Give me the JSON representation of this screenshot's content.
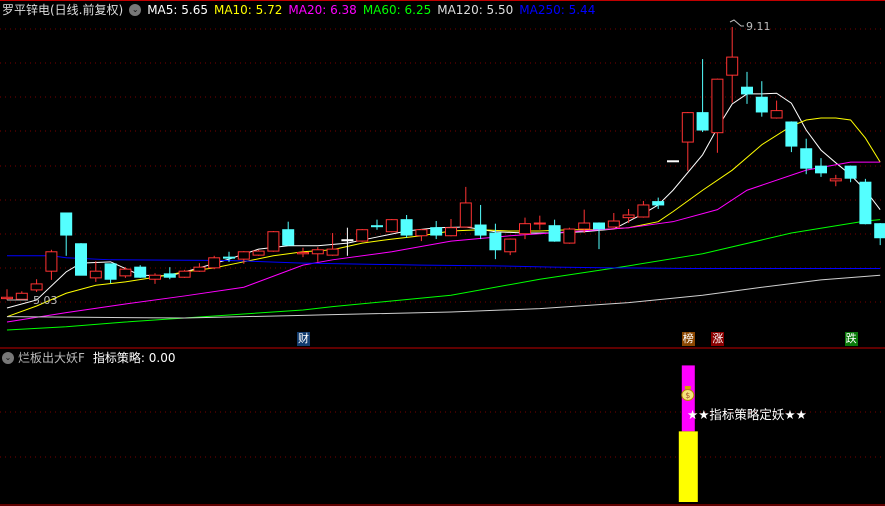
{
  "header": {
    "title": "罗平锌电(日线.前复权)",
    "ma": [
      {
        "label": "MA5: 5.65",
        "color": "#ffffff"
      },
      {
        "label": "MA10: 5.72",
        "color": "#ffff00"
      },
      {
        "label": "MA20: 6.38",
        "color": "#ff00ff"
      },
      {
        "label": "MA60: 6.25",
        "color": "#00ff00"
      },
      {
        "label": "MA120: 5.50",
        "color": "#dddddd"
      },
      {
        "label": "MA250: 5.44",
        "color": "#0000ff"
      }
    ]
  },
  "annotations": {
    "high_label": "9.11",
    "low_label": "5.03"
  },
  "markers": [
    {
      "text": "财",
      "bar": 21,
      "color": "#123c6e"
    },
    {
      "text": "榜",
      "bar": 47,
      "color": "#8a4600"
    },
    {
      "text": "涨",
      "bar": 49,
      "color": "#8b0000"
    },
    {
      "text": "跌",
      "bar": 58,
      "color": "#0a7a0a"
    }
  ],
  "indicator": {
    "name": "烂板出大妖F",
    "value_label": "指标策略: 0.00",
    "signal_text": "★★指标策略定妖★★",
    "signal_bar": 47,
    "yellow_level": 0.45,
    "magenta_level": 0.87,
    "yellow_color": "#ffff00",
    "magenta_color": "#ff00ff"
  },
  "chart_data": {
    "type": "candlestick",
    "ylim": [
      4.55,
      9.25
    ],
    "up_color": "#ff3333",
    "down_color": "#54ffff",
    "ohlc": [
      [
        5.05,
        5.19,
        5.03,
        5.07
      ],
      [
        5.04,
        5.16,
        5.03,
        5.13
      ],
      [
        5.18,
        5.34,
        5.15,
        5.27
      ],
      [
        5.46,
        5.78,
        5.33,
        5.75
      ],
      [
        6.33,
        6.33,
        5.69,
        6.0
      ],
      [
        5.87,
        5.88,
        5.4,
        5.4
      ],
      [
        5.36,
        5.61,
        5.3,
        5.46
      ],
      [
        5.57,
        5.57,
        5.28,
        5.34
      ],
      [
        5.39,
        5.52,
        5.36,
        5.49
      ],
      [
        5.52,
        5.55,
        5.36,
        5.37
      ],
      [
        5.34,
        5.43,
        5.27,
        5.4
      ],
      [
        5.42,
        5.52,
        5.34,
        5.37
      ],
      [
        5.37,
        5.48,
        5.36,
        5.46
      ],
      [
        5.46,
        5.58,
        5.45,
        5.52
      ],
      [
        5.51,
        5.69,
        5.49,
        5.66
      ],
      [
        5.67,
        5.75,
        5.6,
        5.66
      ],
      [
        5.64,
        5.76,
        5.57,
        5.75
      ],
      [
        5.7,
        5.78,
        5.69,
        5.76
      ],
      [
        5.76,
        6.06,
        5.75,
        6.05
      ],
      [
        6.08,
        6.2,
        5.84,
        5.85
      ],
      [
        5.72,
        5.81,
        5.67,
        5.74
      ],
      [
        5.72,
        5.82,
        5.6,
        5.78
      ],
      [
        5.7,
        6.03,
        5.69,
        5.79
      ],
      [
        5.93,
        6.11,
        5.69,
        5.93
      ],
      [
        5.91,
        6.09,
        5.9,
        6.08
      ],
      [
        6.14,
        6.23,
        6.08,
        6.13
      ],
      [
        6.05,
        6.24,
        6.04,
        6.23
      ],
      [
        6.23,
        6.3,
        5.96,
        6.0
      ],
      [
        5.99,
        6.09,
        5.91,
        6.08
      ],
      [
        6.11,
        6.21,
        5.94,
        6.0
      ],
      [
        5.99,
        6.24,
        5.98,
        6.11
      ],
      [
        6.12,
        6.72,
        6.11,
        6.48
      ],
      [
        6.15,
        6.45,
        5.94,
        6.0
      ],
      [
        6.03,
        6.17,
        5.64,
        5.78
      ],
      [
        5.75,
        5.95,
        5.7,
        5.94
      ],
      [
        6.02,
        6.26,
        5.94,
        6.17
      ],
      [
        6.17,
        6.29,
        6.08,
        6.18
      ],
      [
        6.14,
        6.23,
        5.9,
        5.91
      ],
      [
        5.88,
        6.11,
        5.87,
        6.09
      ],
      [
        6.09,
        6.38,
        6.03,
        6.18
      ],
      [
        6.18,
        6.19,
        5.79,
        6.09
      ],
      [
        6.12,
        6.33,
        6.11,
        6.21
      ],
      [
        6.26,
        6.39,
        6.18,
        6.3
      ],
      [
        6.27,
        6.51,
        6.26,
        6.45
      ],
      [
        6.5,
        6.56,
        6.39,
        6.45
      ],
      [
        7.11,
        7.11,
        7.11,
        7.11
      ],
      [
        7.39,
        7.84,
        6.96,
        7.83
      ],
      [
        7.83,
        8.63,
        7.54,
        7.57
      ],
      [
        7.53,
        8.34,
        7.23,
        8.33
      ],
      [
        8.39,
        9.11,
        7.98,
        8.66
      ],
      [
        8.21,
        8.44,
        7.96,
        8.11
      ],
      [
        8.06,
        8.3,
        7.77,
        7.84
      ],
      [
        7.75,
        8.01,
        7.74,
        7.86
      ],
      [
        7.69,
        7.7,
        7.24,
        7.33
      ],
      [
        7.29,
        7.44,
        6.91,
        7.0
      ],
      [
        7.03,
        7.15,
        6.87,
        6.93
      ],
      [
        6.81,
        6.9,
        6.73,
        6.84
      ],
      [
        7.03,
        7.04,
        6.79,
        6.85
      ],
      [
        6.79,
        6.84,
        6.16,
        6.17
      ],
      [
        6.17,
        6.18,
        5.85,
        5.96
      ]
    ],
    "ma_series": [
      {
        "name": "MA5",
        "color": "#ffffff",
        "points": [
          [
            1,
            4.91
          ],
          [
            3,
            5.03
          ],
          [
            5,
            5.45
          ],
          [
            6,
            5.58
          ],
          [
            8,
            5.6
          ],
          [
            10,
            5.4
          ],
          [
            12,
            5.39
          ],
          [
            14,
            5.51
          ],
          [
            16,
            5.64
          ],
          [
            18,
            5.79
          ],
          [
            20,
            5.84
          ],
          [
            22,
            5.84
          ],
          [
            24,
            5.88
          ],
          [
            26,
            5.97
          ],
          [
            28,
            6.06
          ],
          [
            30,
            6.11
          ],
          [
            32,
            6.12
          ],
          [
            34,
            6.05
          ],
          [
            36,
            6.03
          ],
          [
            38,
            6.03
          ],
          [
            40,
            6.05
          ],
          [
            42,
            6.09
          ],
          [
            44,
            6.32
          ],
          [
            45,
            6.45
          ],
          [
            46,
            6.67
          ],
          [
            48,
            7.2
          ],
          [
            49,
            7.6
          ],
          [
            50,
            7.96
          ],
          [
            51,
            8.11
          ],
          [
            52,
            8.11
          ],
          [
            53,
            8.12
          ],
          [
            54,
            7.97
          ],
          [
            55,
            7.57
          ],
          [
            56,
            7.27
          ],
          [
            57,
            7.08
          ],
          [
            58,
            6.9
          ],
          [
            59,
            6.67
          ],
          [
            60,
            6.38
          ]
        ]
      },
      {
        "name": "MA10",
        "color": "#ffff00",
        "points": [
          [
            1,
            4.78
          ],
          [
            3,
            4.94
          ],
          [
            5,
            5.13
          ],
          [
            7,
            5.25
          ],
          [
            9,
            5.3
          ],
          [
            11,
            5.37
          ],
          [
            13,
            5.45
          ],
          [
            15,
            5.51
          ],
          [
            17,
            5.6
          ],
          [
            19,
            5.69
          ],
          [
            21,
            5.75
          ],
          [
            23,
            5.78
          ],
          [
            25,
            5.88
          ],
          [
            27,
            5.94
          ],
          [
            29,
            5.99
          ],
          [
            31,
            6.06
          ],
          [
            33,
            6.08
          ],
          [
            35,
            6.06
          ],
          [
            37,
            6.06
          ],
          [
            39,
            6.08
          ],
          [
            41,
            6.08
          ],
          [
            43,
            6.11
          ],
          [
            45,
            6.2
          ],
          [
            46,
            6.35
          ],
          [
            48,
            6.67
          ],
          [
            50,
            6.97
          ],
          [
            52,
            7.35
          ],
          [
            54,
            7.63
          ],
          [
            55,
            7.72
          ],
          [
            56,
            7.75
          ],
          [
            57,
            7.75
          ],
          [
            58,
            7.72
          ],
          [
            59,
            7.45
          ],
          [
            60,
            7.09
          ]
        ]
      },
      {
        "name": "MA20",
        "color": "#ff00ff",
        "points": [
          [
            1,
            4.7
          ],
          [
            5,
            4.84
          ],
          [
            9,
            4.97
          ],
          [
            13,
            5.09
          ],
          [
            17,
            5.22
          ],
          [
            21,
            5.55
          ],
          [
            23,
            5.63
          ],
          [
            27,
            5.75
          ],
          [
            31,
            5.91
          ],
          [
            35,
            5.99
          ],
          [
            39,
            6.05
          ],
          [
            43,
            6.11
          ],
          [
            45,
            6.17
          ],
          [
            46,
            6.2
          ],
          [
            49,
            6.38
          ],
          [
            51,
            6.67
          ],
          [
            55,
            6.97
          ],
          [
            58,
            7.09
          ],
          [
            60,
            7.09
          ]
        ]
      },
      {
        "name": "MA60",
        "color": "#00ff00",
        "points": [
          [
            1,
            4.58
          ],
          [
            5,
            4.63
          ],
          [
            9,
            4.7
          ],
          [
            13,
            4.76
          ],
          [
            17,
            4.82
          ],
          [
            21,
            4.88
          ],
          [
            23,
            4.93
          ],
          [
            31,
            5.1
          ],
          [
            37,
            5.34
          ],
          [
            43,
            5.54
          ],
          [
            48,
            5.72
          ],
          [
            54,
            6.03
          ],
          [
            59,
            6.21
          ],
          [
            60,
            6.23
          ]
        ]
      },
      {
        "name": "MA120",
        "color": "#d0d0d0",
        "points": [
          [
            1,
            4.78
          ],
          [
            7,
            4.77
          ],
          [
            13,
            4.76
          ],
          [
            17,
            4.78
          ],
          [
            21,
            4.8
          ],
          [
            23,
            4.81
          ],
          [
            31,
            4.85
          ],
          [
            37,
            4.9
          ],
          [
            43,
            4.99
          ],
          [
            48,
            5.1
          ],
          [
            52,
            5.22
          ],
          [
            56,
            5.33
          ],
          [
            60,
            5.4
          ]
        ]
      },
      {
        "name": "MA250",
        "color": "#0000ff",
        "points": [
          [
            1,
            5.69
          ],
          [
            4,
            5.69
          ],
          [
            5,
            5.66
          ],
          [
            8,
            5.63
          ],
          [
            16,
            5.62
          ],
          [
            21,
            5.58
          ],
          [
            24,
            5.57
          ],
          [
            29,
            5.55
          ],
          [
            34,
            5.54
          ],
          [
            38,
            5.52
          ],
          [
            42,
            5.51
          ],
          [
            47,
            5.5
          ],
          [
            60,
            5.5
          ]
        ]
      }
    ]
  }
}
